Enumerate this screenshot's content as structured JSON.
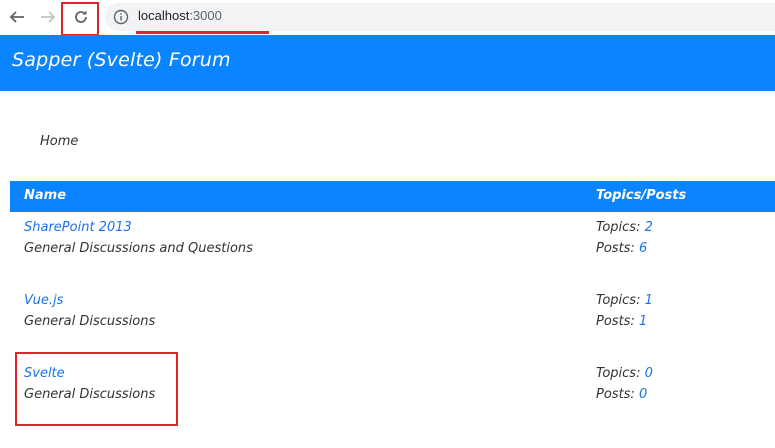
{
  "browser": {
    "url_host": "localhost",
    "url_port": ":3000",
    "icons": {
      "back": "back-arrow-icon",
      "forward": "forward-arrow-icon",
      "reload": "reload-icon",
      "info": "info-icon"
    }
  },
  "app": {
    "title": "Sapper (Svelte)   Forum",
    "accent_color": "#0a84ff"
  },
  "breadcrumb": "Home",
  "table": {
    "headers": {
      "name": "Name",
      "stats": "Topics/Posts"
    },
    "topics_label": "Topics: ",
    "posts_label": "Posts: ",
    "rows": [
      {
        "name": "SharePoint 2013",
        "description": "General Discussions and Questions",
        "topics": "2",
        "posts": "6"
      },
      {
        "name": "Vue.js",
        "description": "General Discussions",
        "topics": "1",
        "posts": "1"
      },
      {
        "name": "Svelte",
        "description": "General Discussions",
        "topics": "0",
        "posts": "0"
      }
    ]
  }
}
